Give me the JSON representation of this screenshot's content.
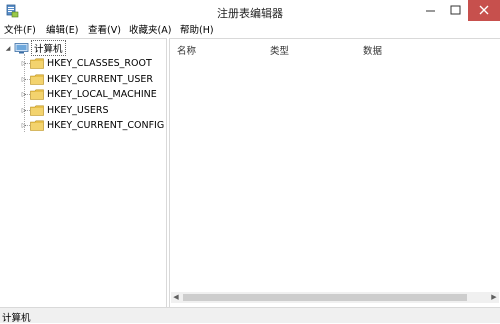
{
  "window": {
    "title": "注册表编辑器"
  },
  "menu": {
    "file": "文件(F)",
    "edit": "编辑(E)",
    "view": "查看(V)",
    "favorites": "收藏夹(A)",
    "help": "帮助(H)"
  },
  "tree": {
    "root": {
      "label": "计算机",
      "expanded": true
    },
    "items": [
      {
        "label": "HKEY_CLASSES_ROOT"
      },
      {
        "label": "HKEY_CURRENT_USER"
      },
      {
        "label": "HKEY_LOCAL_MACHINE"
      },
      {
        "label": "HKEY_USERS"
      },
      {
        "label": "HKEY_CURRENT_CONFIG"
      }
    ]
  },
  "list": {
    "columns": {
      "name": "名称",
      "type": "类型",
      "data": "数据"
    }
  },
  "status": {
    "path": "计算机"
  },
  "colors": {
    "close_button": "#c7504d",
    "folder": "#e8c04c",
    "chrome": "#f0f0f0"
  }
}
